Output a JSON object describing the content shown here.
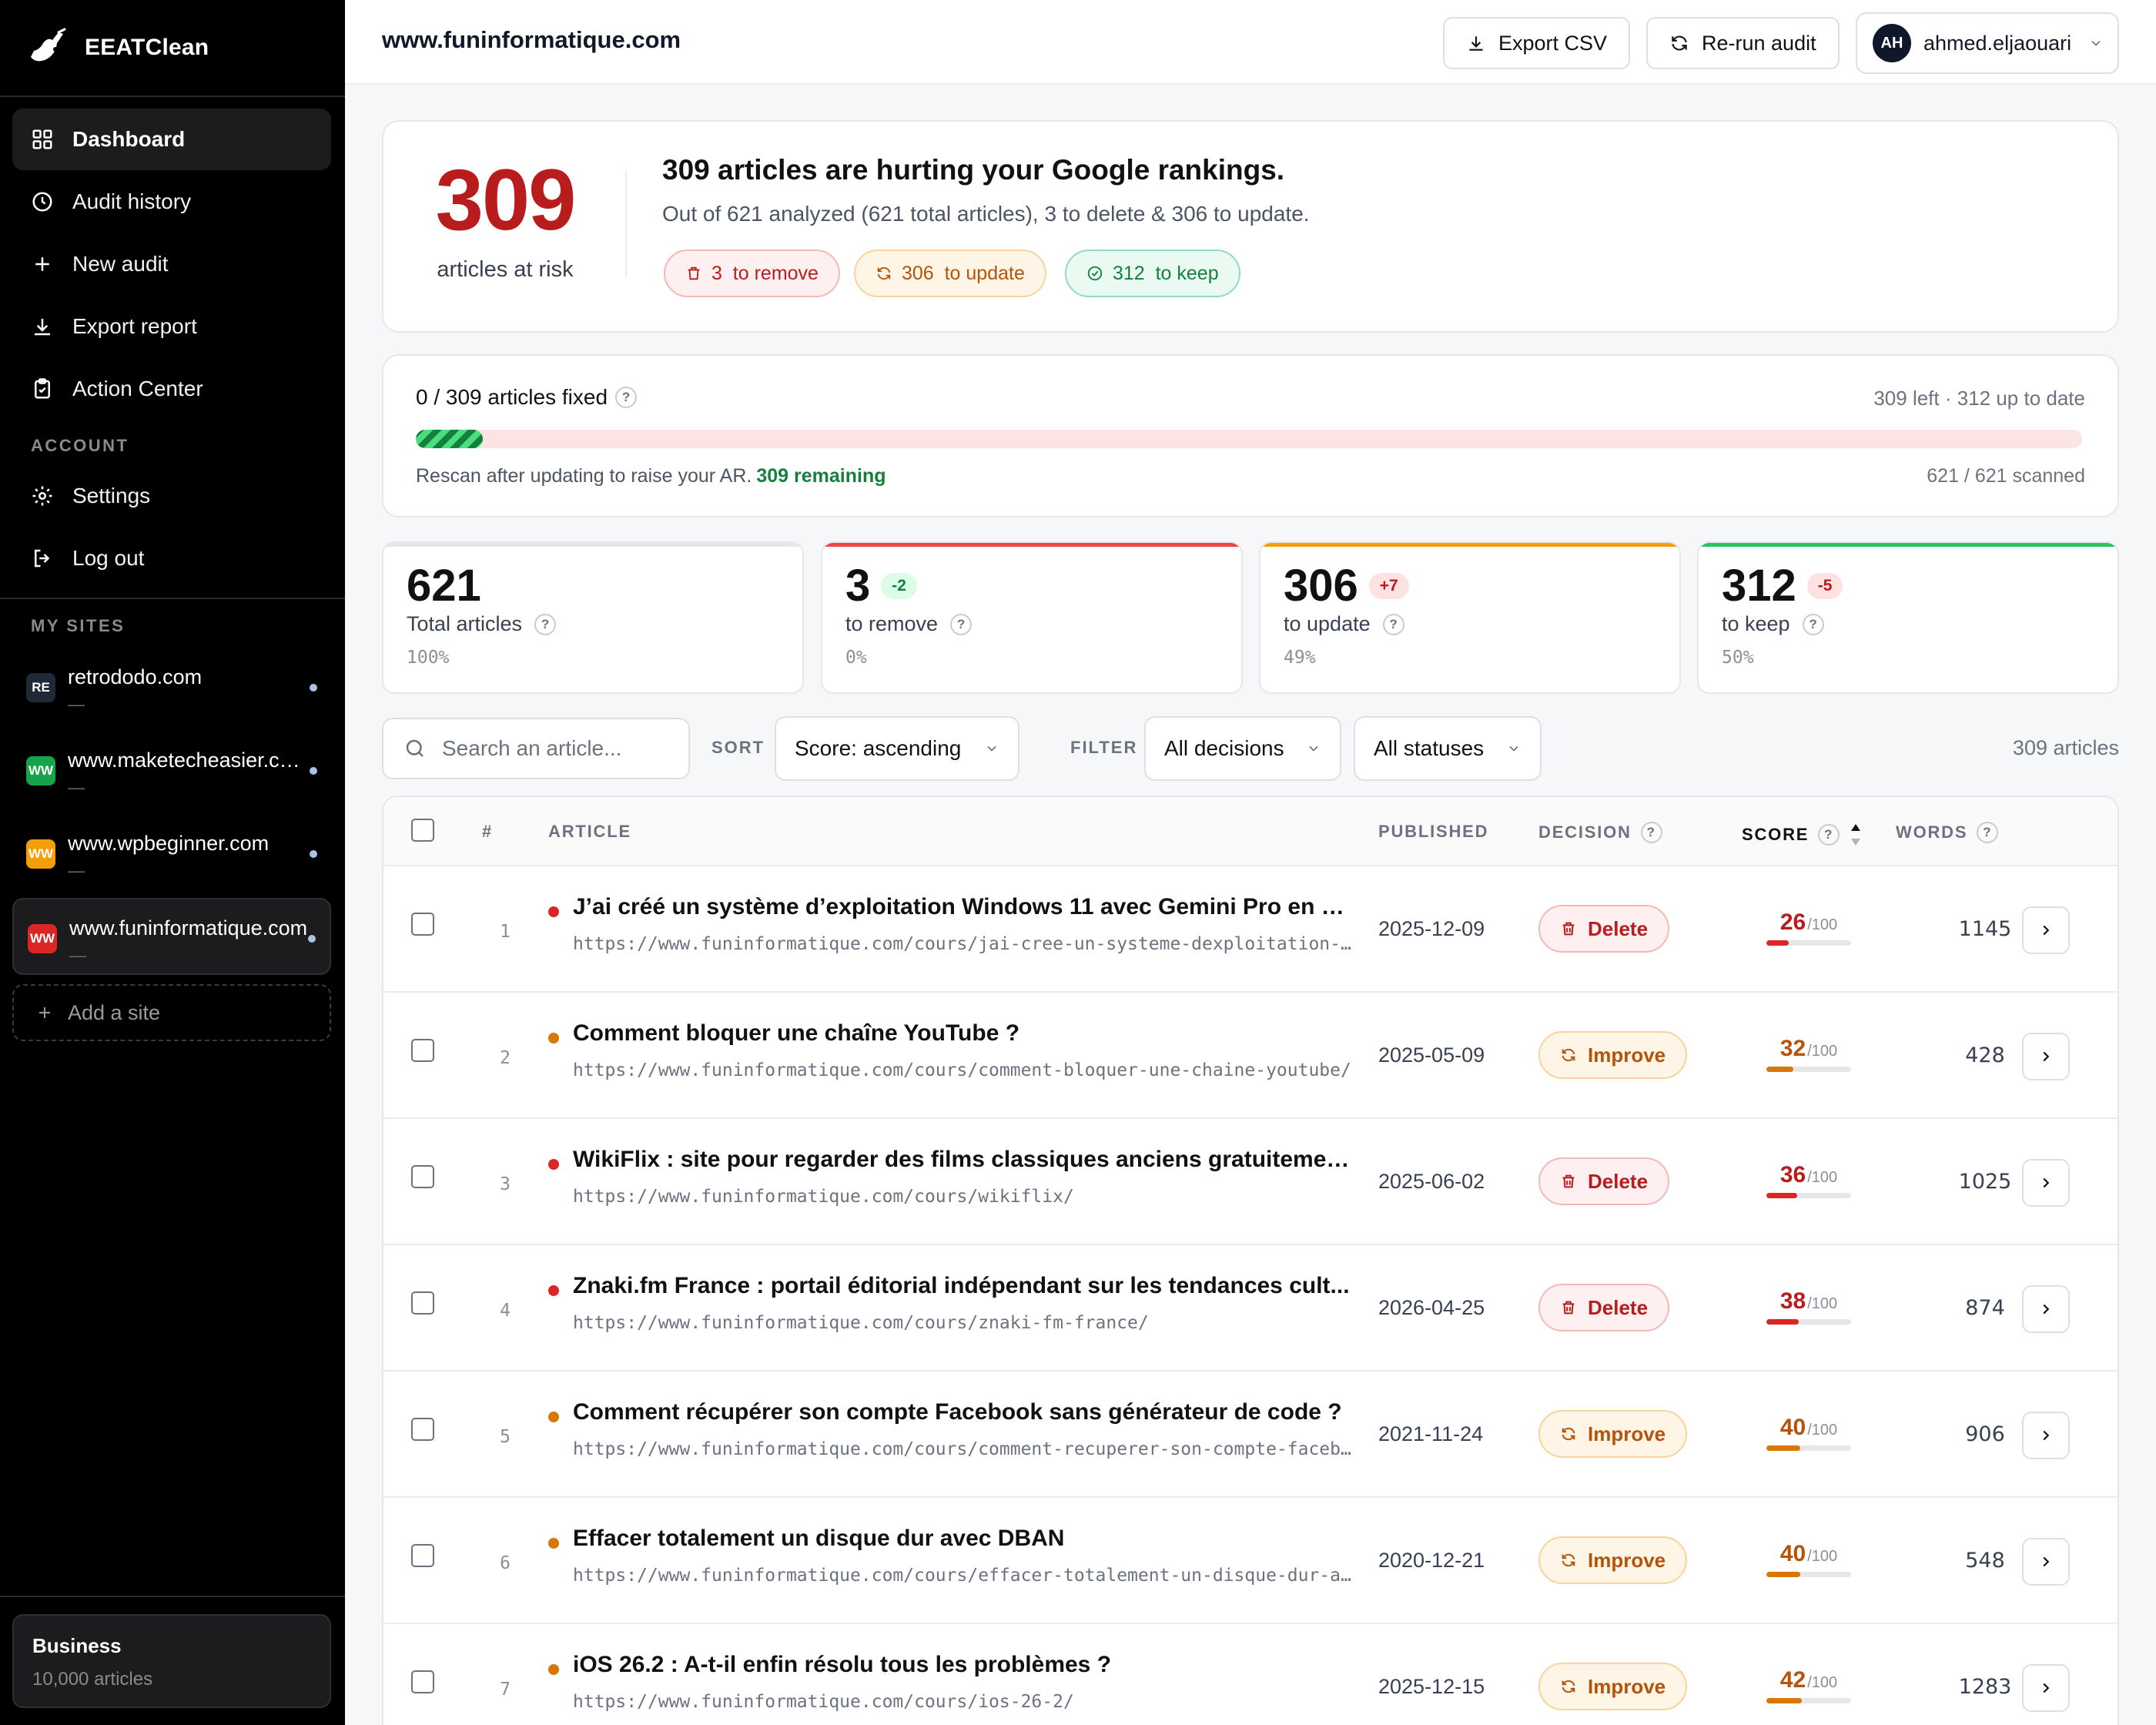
{
  "app": {
    "name": "EEATClean"
  },
  "sidebar": {
    "nav": [
      {
        "label": "Dashboard",
        "icon": "grid-icon",
        "active": true
      },
      {
        "label": "Audit history",
        "icon": "clock-icon"
      },
      {
        "label": "New audit",
        "icon": "plus-icon"
      },
      {
        "label": "Export report",
        "icon": "download-icon"
      },
      {
        "label": "Action Center",
        "icon": "clipboard-icon"
      }
    ],
    "account_label": "ACCOUNT",
    "account": [
      {
        "label": "Settings",
        "icon": "gear-icon"
      },
      {
        "label": "Log out",
        "icon": "logout-icon"
      }
    ],
    "sites_label": "MY SITES",
    "sites": [
      {
        "badge": "RE",
        "name": "retrododo.com",
        "sub": "—",
        "color": "#1f2937"
      },
      {
        "badge": "WW",
        "name": "www.maketecheasier.com",
        "sub": "—",
        "color": "#16a34a"
      },
      {
        "badge": "WW",
        "name": "www.wpbeginner.com",
        "sub": "—",
        "color": "#f59e0b"
      },
      {
        "badge": "WW",
        "name": "www.funinformatique.com",
        "sub": "—",
        "color": "#dc2626",
        "active": true
      }
    ],
    "add_site": "Add a site",
    "plan": {
      "name": "Business",
      "sub": "10,000 articles"
    }
  },
  "header": {
    "domain": "www.funinformatique.com",
    "export_csv": "Export CSV",
    "rerun": "Re-run audit",
    "user_initials": "AH",
    "user_name": "ahmed.eljaouari"
  },
  "risk": {
    "count": "309",
    "label": "articles at risk",
    "headline": "309 articles are hurting your Google rankings.",
    "sub": "Out of 621 analyzed (621 total articles), 3 to delete & 306 to update.",
    "pill_remove": "3  to remove",
    "pill_update": "306  to update",
    "pill_keep": "312  to keep"
  },
  "progress": {
    "title": "0 / 309 articles fixed",
    "right": "309 left · 312 up to date",
    "fraction": 0.04,
    "note": "Rescan after updating to raise your AR.",
    "note_highlight": "309 remaining",
    "scanned": "621 / 621 scanned"
  },
  "stats": [
    {
      "value": "621",
      "delta": "",
      "label": "Total articles",
      "pct": "100%",
      "accent": "#e5e7eb"
    },
    {
      "value": "3",
      "delta": "-2",
      "delta_kind": "g",
      "label": "to remove",
      "pct": "0%",
      "accent": "#ef4444"
    },
    {
      "value": "306",
      "delta": "+7",
      "delta_kind": "r",
      "label": "to update",
      "pct": "49%",
      "accent": "#f59e0b"
    },
    {
      "value": "312",
      "delta": "-5",
      "delta_kind": "r",
      "label": "to keep",
      "pct": "50%",
      "accent": "#22c55e"
    }
  ],
  "controls": {
    "search_placeholder": "Search an article...",
    "sort_label": "SORT",
    "sort_value": "Score: ascending",
    "filter_label": "FILTER",
    "filter_decision": "All decisions",
    "filter_status": "All statuses",
    "count": "309 articles"
  },
  "table": {
    "headers": {
      "num": "#",
      "article": "ARTICLE",
      "published": "PUBLISHED",
      "decision": "DECISION",
      "score": "SCORE",
      "words": "WORDS"
    },
    "rows": [
      {
        "num": "1",
        "title": "J’ai créé un système d’exploitation Windows 11 avec Gemini Pro en m...",
        "url": "https://www.funinformatique.com/cours/jai-cree-un-systeme-dexploitation-windows-...",
        "date": "2025-12-09",
        "decision": "Delete",
        "score": 26,
        "score_max": "/100",
        "words": "1145"
      },
      {
        "num": "2",
        "title": "Comment bloquer une chaîne YouTube ?",
        "url": "https://www.funinformatique.com/cours/comment-bloquer-une-chaine-youtube/",
        "date": "2025-05-09",
        "decision": "Improve",
        "score": 32,
        "score_max": "/100",
        "words": "428"
      },
      {
        "num": "3",
        "title": "WikiFlix : site pour regarder des films classiques anciens gratuitemen...",
        "url": "https://www.funinformatique.com/cours/wikiflix/",
        "date": "2025-06-02",
        "decision": "Delete",
        "score": 36,
        "score_max": "/100",
        "words": "1025"
      },
      {
        "num": "4",
        "title": "Znaki.fm France : portail éditorial indépendant sur les tendances cult...",
        "url": "https://www.funinformatique.com/cours/znaki-fm-france/",
        "date": "2026-04-25",
        "decision": "Delete",
        "score": 38,
        "score_max": "/100",
        "words": "874"
      },
      {
        "num": "5",
        "title": "Comment récupérer son compte Facebook sans générateur de code ?",
        "url": "https://www.funinformatique.com/cours/comment-recuperer-son-compte-facebook-...",
        "date": "2021-11-24",
        "decision": "Improve",
        "score": 40,
        "score_max": "/100",
        "words": "906"
      },
      {
        "num": "6",
        "title": "Effacer totalement un disque dur avec DBAN",
        "url": "https://www.funinformatique.com/cours/effacer-totalement-un-disque-dur-avec-dban/",
        "date": "2020-12-21",
        "decision": "Improve",
        "score": 40,
        "score_max": "/100",
        "words": "548"
      },
      {
        "num": "7",
        "title": "iOS 26.2 : A-t-il enfin résolu tous les problèmes ?",
        "url": "https://www.funinformatique.com/cours/ios-26-2/",
        "date": "2025-12-15",
        "decision": "Improve",
        "score": 42,
        "score_max": "/100",
        "words": "1283"
      }
    ]
  },
  "colors": {
    "danger": "#b91c1c",
    "warning": "#b45309",
    "success": "#15803d"
  }
}
